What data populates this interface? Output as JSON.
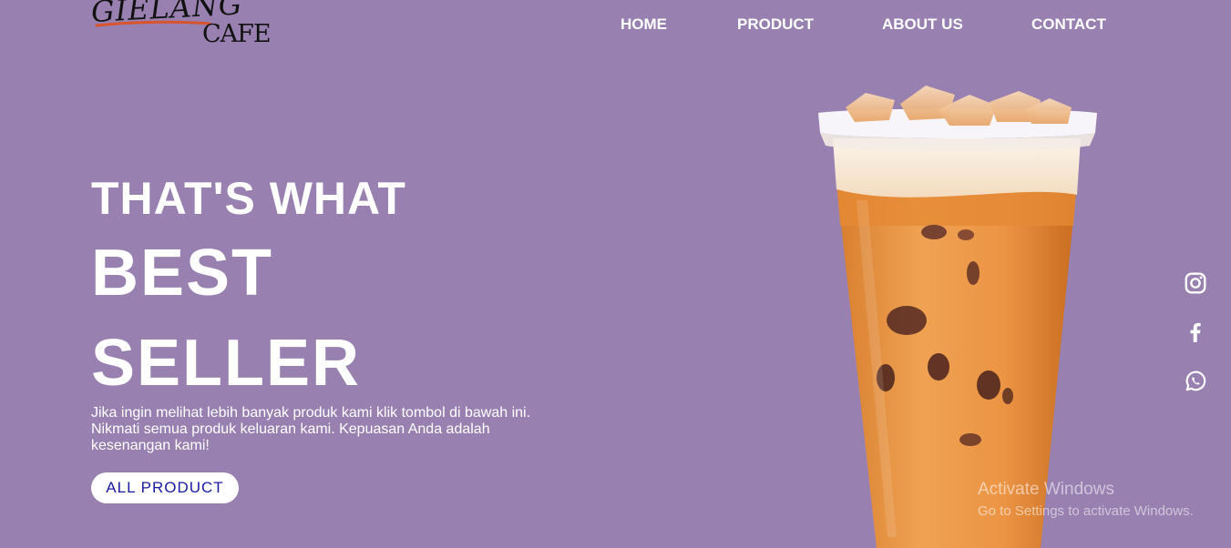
{
  "logo": {
    "line1": "GIELANG",
    "line2": "CAFE"
  },
  "nav": {
    "items": [
      {
        "label": "HOME"
      },
      {
        "label": "PRODUCT"
      },
      {
        "label": "ABOUT US"
      },
      {
        "label": "CONTACT"
      }
    ]
  },
  "hero": {
    "line1": "THAT'S WHAT",
    "line2": "BEST",
    "line3": "SELLER",
    "description": "Jika ingin melihat lebih banyak produk kami klik tombol di bawah ini. Nikmati semua produk keluaran kami. Kepuasan Anda adalah kesenangan kami!",
    "cta_label": "ALL PRODUCT"
  },
  "socials": [
    {
      "icon": "instagram-icon"
    },
    {
      "icon": "facebook-icon"
    },
    {
      "icon": "whatsapp-icon"
    }
  ],
  "watermark": {
    "title": "Activate Windows",
    "subtitle": "Go to Settings to activate Windows."
  },
  "colors": {
    "background": "#9880b0",
    "text": "#ffffff",
    "cta_text": "#1a1aa0",
    "logo_swoosh": "#d9532b"
  }
}
